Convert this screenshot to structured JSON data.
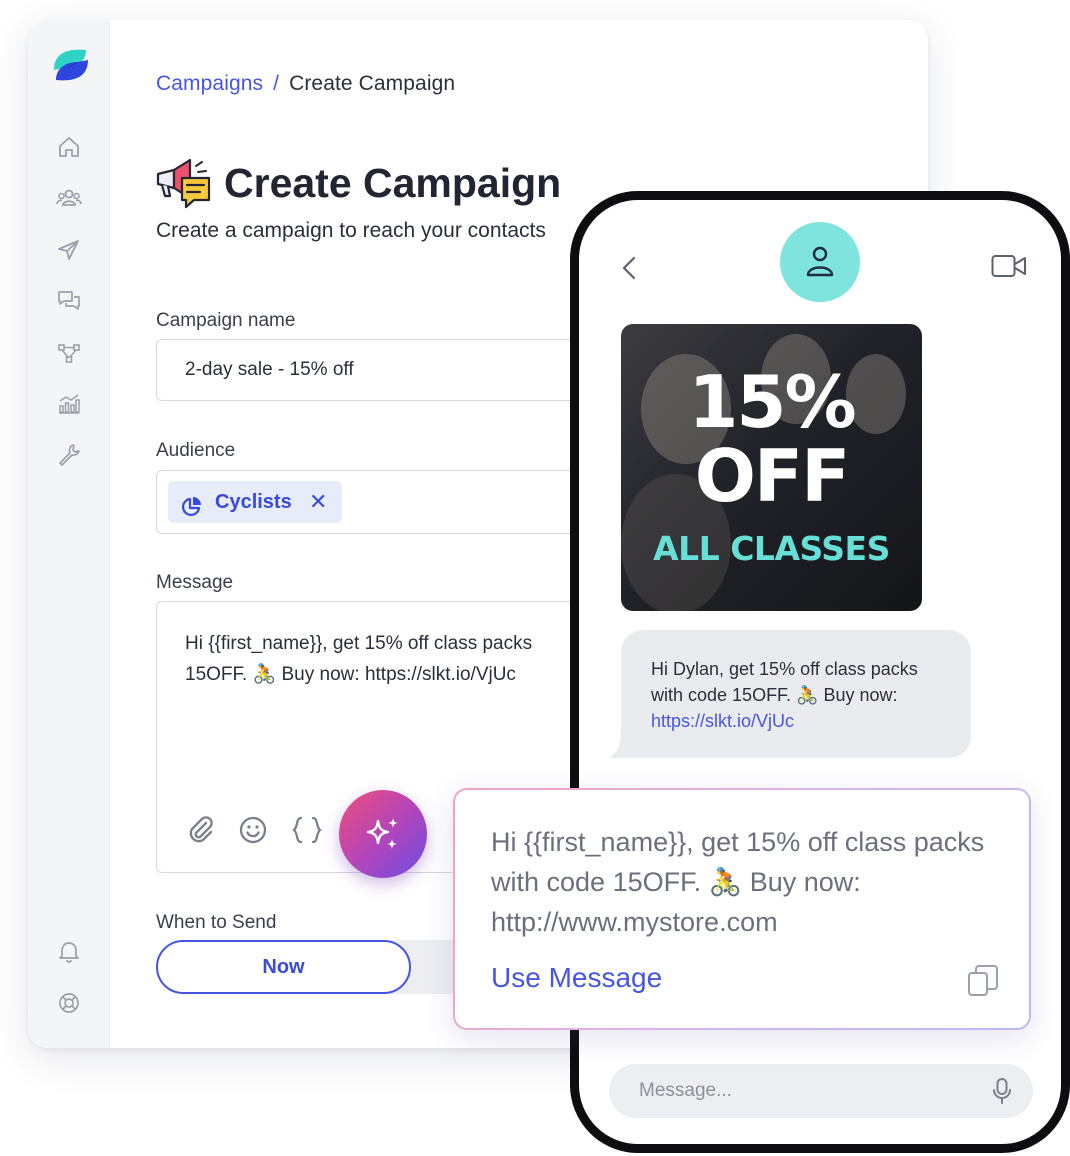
{
  "breadcrumb": {
    "parent": "Campaigns",
    "separator": "/",
    "current": "Create Campaign"
  },
  "page": {
    "title": "Create Campaign",
    "subtitle": "Create a campaign to reach your contacts"
  },
  "form": {
    "name_label": "Campaign name",
    "name_value": "2-day sale - 15% off",
    "audience_label": "Audience",
    "audience_chip": "Cyclists",
    "audience_chip_remove": "✕",
    "message_label": "Message",
    "message_line1": "Hi {{first_name}}, get 15% off class packs",
    "message_line2": "15OFF. 🚴 Buy now: https://slkt.io/VjUc",
    "when_label": "When to Send",
    "now_button": "Now"
  },
  "sidebar": {
    "items": [
      "home-icon",
      "contacts-icon",
      "send-icon",
      "chat-icon",
      "workflow-icon",
      "analytics-icon",
      "tools-icon"
    ],
    "bottom": [
      "bell-icon",
      "help-icon"
    ]
  },
  "phone": {
    "promo": {
      "line1": "15%",
      "line2": "OFF",
      "line3": "ALL CLASSES"
    },
    "bubble_text": "Hi Dylan, get 15% off class packs with code 15OFF. 🚴 Buy now:",
    "bubble_link": "https://slkt.io/VjUc",
    "input_placeholder": "Message..."
  },
  "suggestion": {
    "text": "Hi {{first_name}}, get 15% off class packs with code 15OFF. 🚴 Buy now: http://www.mystore.com",
    "use_label": "Use Message"
  },
  "colors": {
    "accent": "#4655e4",
    "teal": "#7ee4dd",
    "promo_teal": "#67dfd6",
    "chip_bg": "#e7ecfb"
  }
}
